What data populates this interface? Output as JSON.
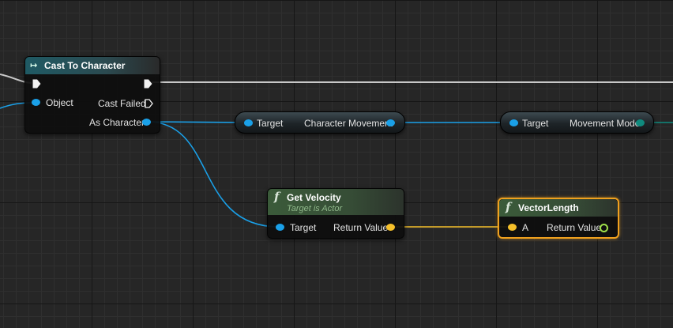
{
  "colors": {
    "object_pin": "#1aa0e8",
    "struct_pin": "#f5c02a",
    "float_pin": "#9ee04a",
    "enum_pin": "#0f8a7e",
    "selection": "#f0a11e",
    "pure_header": "#3b5b3a",
    "cast_header": "#1f5a64"
  },
  "nodes": {
    "cast": {
      "icon": "cast-icon",
      "title": "Cast To Character",
      "pin_object": "Object",
      "pin_cast_failed": "Cast Failed",
      "pin_as_character": "As Character"
    },
    "character_movement": {
      "pin_target": "Target",
      "pin_output": "Character Movement"
    },
    "movement_mode": {
      "pin_target": "Target",
      "pin_output": "Movement Mode"
    },
    "get_velocity": {
      "icon": "function-icon",
      "title": "Get Velocity",
      "subtitle": "Target is Actor",
      "pin_target": "Target",
      "pin_return": "Return Value"
    },
    "vector_length": {
      "icon": "function-icon",
      "title": "VectorLength",
      "pin_a": "A",
      "pin_return": "Return Value"
    }
  }
}
